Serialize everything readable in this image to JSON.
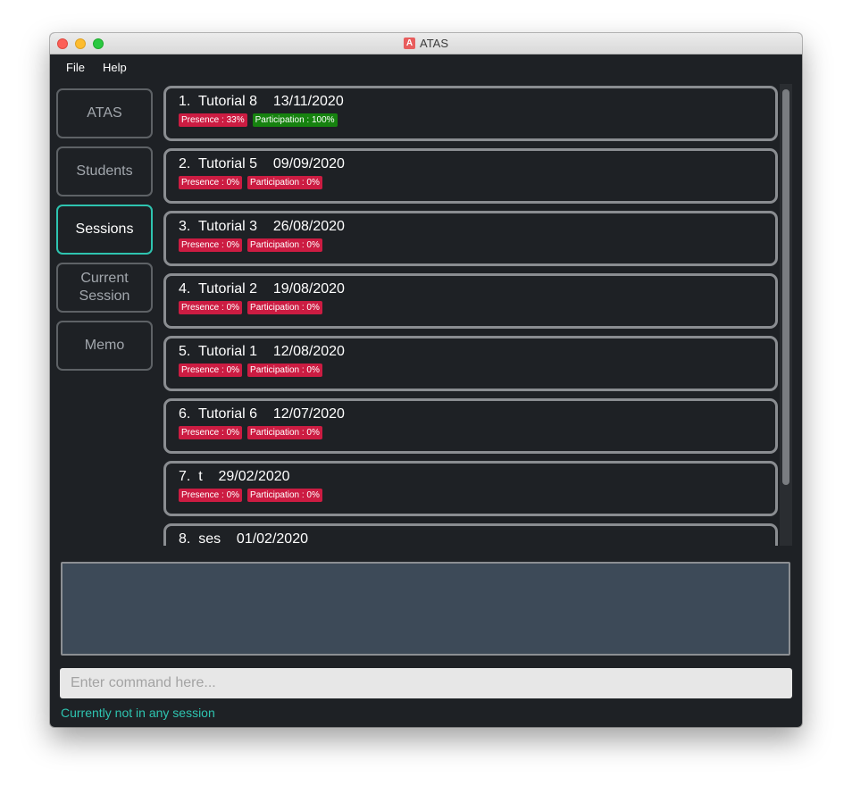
{
  "window": {
    "title": "ATAS",
    "app_icon_letter": "A"
  },
  "menu": {
    "file": "File",
    "help": "Help"
  },
  "sidebar": {
    "items": [
      {
        "label": "ATAS",
        "active": false
      },
      {
        "label": "Students",
        "active": false
      },
      {
        "label": "Sessions",
        "active": true
      },
      {
        "label": "Current Session",
        "active": false
      },
      {
        "label": "Memo",
        "active": false
      }
    ]
  },
  "sessions": [
    {
      "title": "1.  Tutorial 8    13/11/2020",
      "presence": "Presence : 33%",
      "participation": "Participation : 100%",
      "presence_color": "#cc1c42",
      "participation_color": "#16820f"
    },
    {
      "title": "2.  Tutorial 5    09/09/2020",
      "presence": "Presence : 0%",
      "participation": "Participation : 0%",
      "presence_color": "#cc1c42",
      "participation_color": "#cc1c42"
    },
    {
      "title": "3.  Tutorial 3    26/08/2020",
      "presence": "Presence : 0%",
      "participation": "Participation : 0%",
      "presence_color": "#cc1c42",
      "participation_color": "#cc1c42"
    },
    {
      "title": "4.  Tutorial 2    19/08/2020",
      "presence": "Presence : 0%",
      "participation": "Participation : 0%",
      "presence_color": "#cc1c42",
      "participation_color": "#cc1c42"
    },
    {
      "title": "5.  Tutorial 1    12/08/2020",
      "presence": "Presence : 0%",
      "participation": "Participation : 0%",
      "presence_color": "#cc1c42",
      "participation_color": "#cc1c42"
    },
    {
      "title": "6.  Tutorial 6    12/07/2020",
      "presence": "Presence : 0%",
      "participation": "Participation : 0%",
      "presence_color": "#cc1c42",
      "participation_color": "#cc1c42"
    },
    {
      "title": "7.  t    29/02/2020",
      "presence": "Presence : 0%",
      "participation": "Participation : 0%",
      "presence_color": "#cc1c42",
      "participation_color": "#cc1c42"
    },
    {
      "title": "8.  ses    01/02/2020",
      "presence": "",
      "participation": "",
      "presence_color": "#cc1c42",
      "participation_color": "#cc1c42"
    }
  ],
  "result_display": {
    "text": ""
  },
  "command": {
    "placeholder": "Enter command here...",
    "value": ""
  },
  "status_bar": {
    "text": "Currently not in any session"
  },
  "colors": {
    "accent": "#2ec4b0",
    "background": "#1e2125",
    "result_bg": "#3d4a58"
  }
}
